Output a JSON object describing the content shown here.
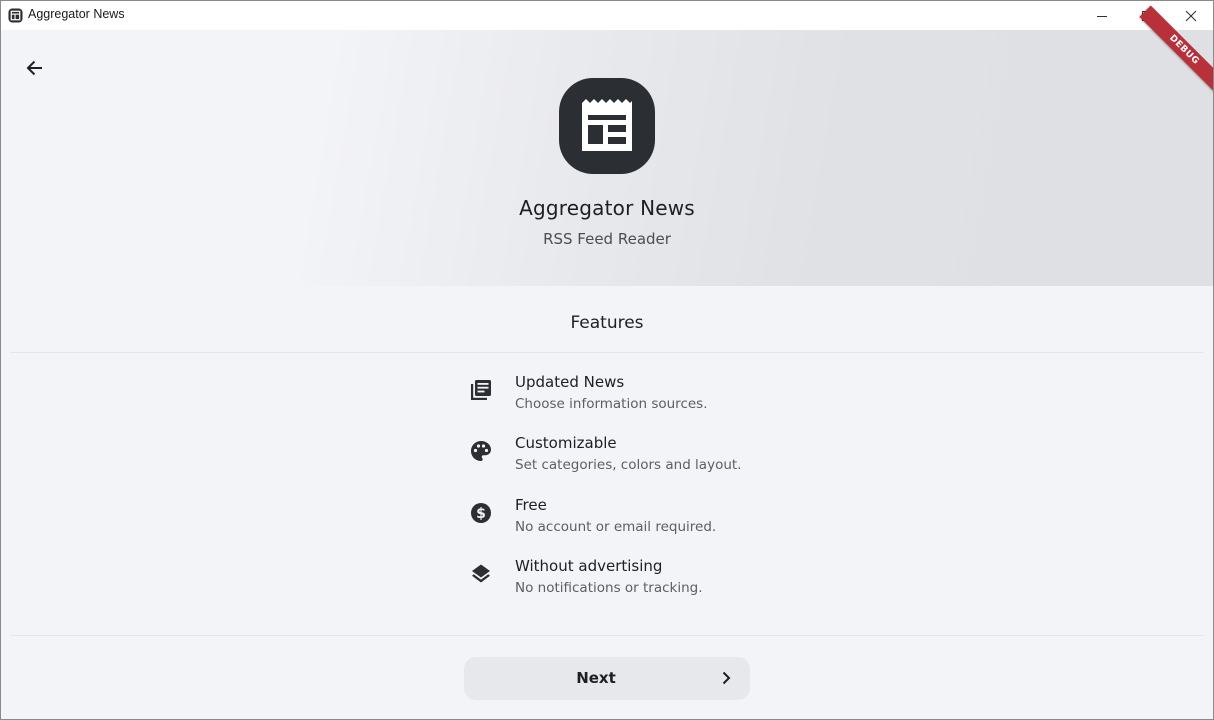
{
  "window": {
    "title": "Aggregator News",
    "icon": "newspaper-icon"
  },
  "header": {
    "back_icon": "arrow-back-icon",
    "app_name": "Aggregator News",
    "app_subtitle": "RSS Feed Reader",
    "debug_label": "DEBUG"
  },
  "features": {
    "heading": "Features",
    "items": [
      {
        "icon": "news-list-icon",
        "title": "Updated News",
        "description": "Choose information sources."
      },
      {
        "icon": "palette-icon",
        "title": "Customizable",
        "description": "Set categories, colors and layout."
      },
      {
        "icon": "dollar-circle-icon",
        "title": "Free",
        "description": "No account or email required."
      },
      {
        "icon": "layers-icon",
        "title": "Without advertising",
        "description": "No notifications or tracking."
      }
    ]
  },
  "footer": {
    "next_label": "Next",
    "next_icon": "chevron-right-icon"
  },
  "colors": {
    "background": "#f3f4f7",
    "logo_background": "#2b2f33",
    "debug_ribbon": "#b8303a",
    "button_background": "#e6e8eb"
  }
}
